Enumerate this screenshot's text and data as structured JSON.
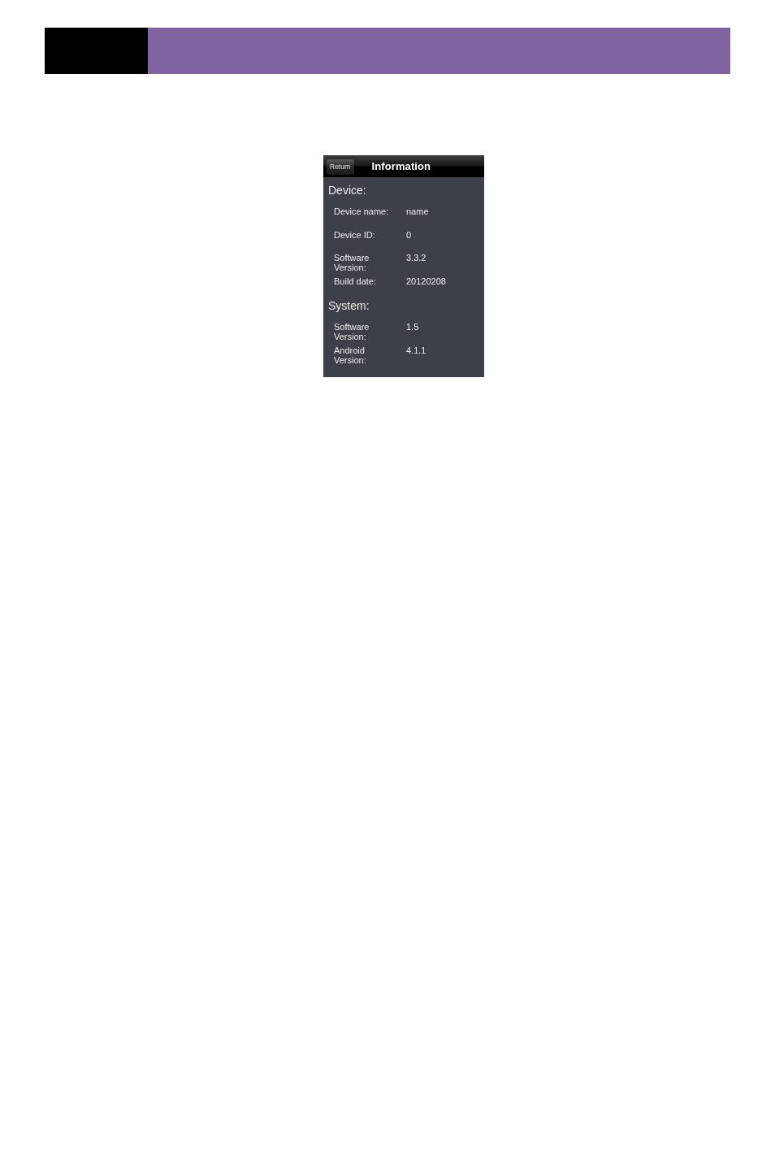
{
  "screen": {
    "title_bar": {
      "back_button": "Return",
      "title": "Information"
    },
    "sections": [
      {
        "heading": "Device:",
        "rows": [
          {
            "label": "Device name:",
            "value": "name"
          },
          {
            "label": "Device ID:",
            "value": "0"
          },
          {
            "label": "Software Version:",
            "value": "3.3.2"
          },
          {
            "label": "Build date:",
            "value": "20120208"
          }
        ]
      },
      {
        "heading": "System:",
        "rows": [
          {
            "label": "Software Version:",
            "value": "1.5"
          },
          {
            "label": "Android Version:",
            "value": "4.1.1"
          }
        ]
      }
    ]
  }
}
